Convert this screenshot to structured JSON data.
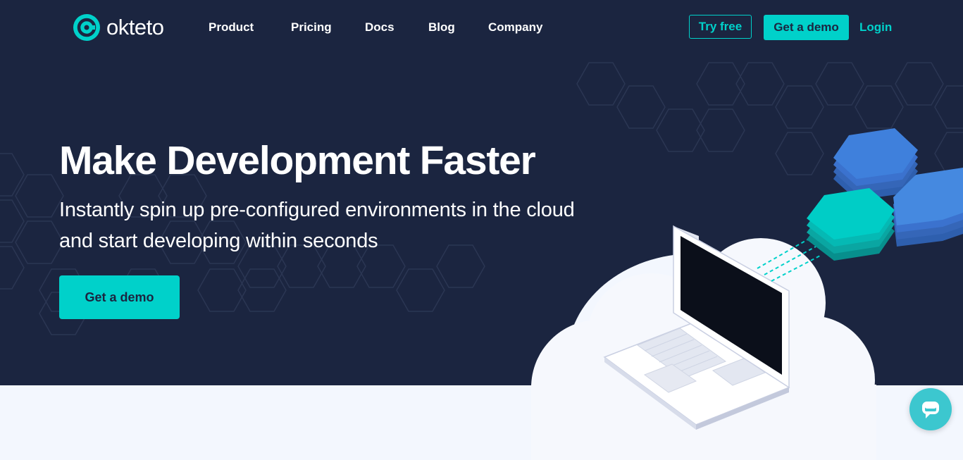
{
  "brand": {
    "name": "okteto"
  },
  "nav": {
    "links": [
      "Product",
      "Pricing",
      "Docs",
      "Blog",
      "Company"
    ],
    "try_free": "Try free",
    "get_demo": "Get a demo",
    "login": "Login"
  },
  "hero": {
    "headline": "Make Development Faster",
    "subheadline": "Instantly spin up pre-configured environments in the cloud and start developing within seconds",
    "cta": "Get a demo"
  },
  "colors": {
    "hero_bg": "#1b2540",
    "accent": "#00d1ca",
    "page_bg": "#f3f7fe",
    "hex_blue": "#3c7fd8"
  },
  "icons": {
    "logo": "okteto-logo-icon",
    "chat": "chat-bubble-icon"
  }
}
